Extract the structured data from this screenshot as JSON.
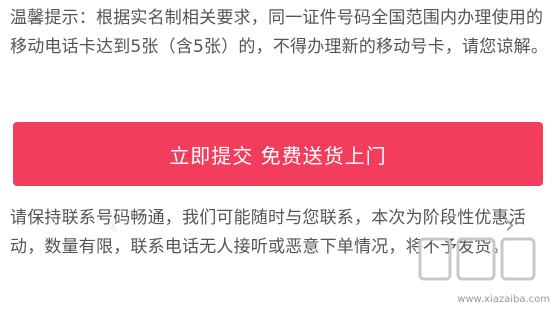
{
  "notice": {
    "text": "温馨提示：根据实名制相关要求，同一证件号码全国范围内办理使用的移动电话卡达到5张（含5张）的，不得办理新的移动号卡，请您谅解。"
  },
  "submit_button": {
    "label": "立即提交 免费送货上门",
    "color": "#f23d5c"
  },
  "note": {
    "text": "请保持联系号码畅通，我们可能随时与您联系，本次为阶段性优惠活动，数量有限，联系电话无人接听或恶意下单情况，将不予发货。"
  },
  "carousel_arrows": {
    "prev_icon": "chevron-left-icon",
    "next_icon": "chevron-right-icon"
  },
  "watermark": {
    "logo_text": "下载吧",
    "site": "www.xiazaiba.com"
  }
}
